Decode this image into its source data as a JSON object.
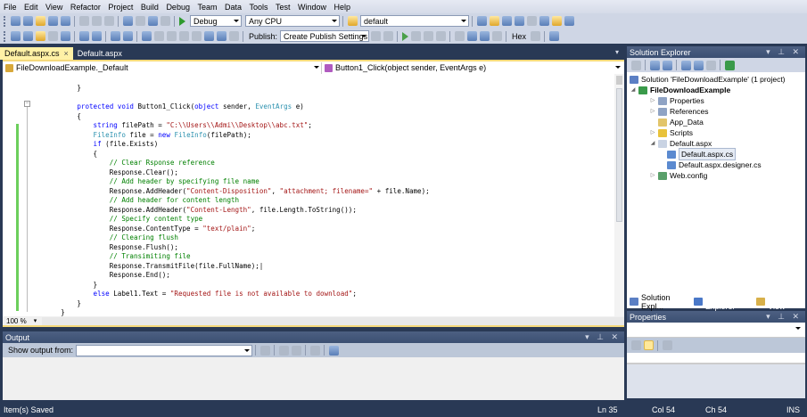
{
  "menu": [
    "File",
    "Edit",
    "View",
    "Refactor",
    "Project",
    "Build",
    "Debug",
    "Team",
    "Data",
    "Tools",
    "Test",
    "Window",
    "Help"
  ],
  "toolbar": {
    "config": "Debug",
    "platform": "Any CPU",
    "find": "default",
    "publish_label": "Publish:",
    "publish_value": "Create Publish Settings",
    "hex": "Hex"
  },
  "tabs": [
    {
      "label": "Default.aspx.cs",
      "close": "×"
    },
    {
      "label": "Default.aspx"
    }
  ],
  "nav": {
    "type": "FileDownloadExample._Default",
    "member": "Button1_Click(object sender, EventArgs e)"
  },
  "code": [
    [
      [
        "p",
        "        }"
      ]
    ],
    [
      [
        "p",
        ""
      ]
    ],
    [
      [
        "p",
        "        "
      ],
      [
        "kw",
        "protected void "
      ],
      [
        "p",
        "Button1_Click("
      ],
      [
        "kw",
        "object"
      ],
      [
        "p",
        " sender, "
      ],
      [
        "ty",
        "EventArgs"
      ],
      [
        "p",
        " e)"
      ]
    ],
    [
      [
        "p",
        "        {"
      ]
    ],
    [
      [
        "p",
        "            "
      ],
      [
        "kw",
        "string"
      ],
      [
        "p",
        " filePath = "
      ],
      [
        "st",
        "\"C:\\\\Users\\\\Admi\\\\Desktop\\\\abc.txt\""
      ],
      [
        "p",
        ";"
      ]
    ],
    [
      [
        "p",
        "            "
      ],
      [
        "ty",
        "FileInfo"
      ],
      [
        "p",
        " file = "
      ],
      [
        "kw",
        "new "
      ],
      [
        "ty",
        "FileInfo"
      ],
      [
        "p",
        "(filePath);"
      ]
    ],
    [
      [
        "p",
        "            "
      ],
      [
        "kw",
        "if"
      ],
      [
        "p",
        " (file.Exists)"
      ]
    ],
    [
      [
        "p",
        "            {"
      ]
    ],
    [
      [
        "p",
        "                "
      ],
      [
        "cm",
        "// Clear Rsponse reference"
      ]
    ],
    [
      [
        "p",
        "                Response.Clear();"
      ]
    ],
    [
      [
        "p",
        "                "
      ],
      [
        "cm",
        "// Add header by specifying file name"
      ]
    ],
    [
      [
        "p",
        "                Response.AddHeader("
      ],
      [
        "st",
        "\"Content-Disposition\""
      ],
      [
        "p",
        ", "
      ],
      [
        "st",
        "\"attachment; filename=\""
      ],
      [
        "p",
        " + file.Name);"
      ]
    ],
    [
      [
        "p",
        "                "
      ],
      [
        "cm",
        "// Add header for content length"
      ]
    ],
    [
      [
        "p",
        "                Response.AddHeader("
      ],
      [
        "st",
        "\"Content-Length\""
      ],
      [
        "p",
        ", file.Length.ToString());"
      ]
    ],
    [
      [
        "p",
        "                "
      ],
      [
        "cm",
        "// Specify content type"
      ]
    ],
    [
      [
        "p",
        "                Response.ContentType = "
      ],
      [
        "st",
        "\"text/plain\""
      ],
      [
        "p",
        ";"
      ]
    ],
    [
      [
        "p",
        "                "
      ],
      [
        "cm",
        "// Clearing flush"
      ]
    ],
    [
      [
        "p",
        "                Response.Flush();"
      ]
    ],
    [
      [
        "p",
        "                "
      ],
      [
        "cm",
        "// Transimiting file"
      ]
    ],
    [
      [
        "p",
        "                Response.TransmitFile(file.FullName);|"
      ]
    ],
    [
      [
        "p",
        "                Response.End();"
      ]
    ],
    [
      [
        "p",
        "            }"
      ]
    ],
    [
      [
        "p",
        "            "
      ],
      [
        "kw",
        "else"
      ],
      [
        "p",
        " Label1.Text = "
      ],
      [
        "st",
        "\"Requested file is not available to download\""
      ],
      [
        "p",
        ";"
      ]
    ],
    [
      [
        "p",
        "        }"
      ]
    ],
    [
      [
        "p",
        "    }"
      ]
    ]
  ],
  "zoom": "100 %",
  "output": {
    "title": "Output",
    "show_label": "Show output from:",
    "source": ""
  },
  "solution_explorer": {
    "title": "Solution Explorer",
    "items": [
      {
        "label": "Solution 'FileDownloadExample' (1 project)",
        "level": 0,
        "exp": "",
        "color": "#5b7fc4"
      },
      {
        "label": "FileDownloadExample",
        "level": 0,
        "exp": "◢",
        "color": "#3a9a4a",
        "bold": true
      },
      {
        "label": "Properties",
        "level": 1,
        "exp": "▷",
        "color": "#8fa3c4"
      },
      {
        "label": "References",
        "level": 1,
        "exp": "▷",
        "color": "#8fa3c4"
      },
      {
        "label": "App_Data",
        "level": 1,
        "exp": "",
        "color": "#e2c56b"
      },
      {
        "label": "Scripts",
        "level": 1,
        "exp": "▷",
        "color": "#e8c23a"
      },
      {
        "label": "Default.aspx",
        "level": 1,
        "exp": "◢",
        "color": "#c9d3e3"
      },
      {
        "label": "Default.aspx.cs",
        "level": 2,
        "exp": "",
        "color": "#5b8ad0",
        "selected": true
      },
      {
        "label": "Default.aspx.designer.cs",
        "level": 2,
        "exp": "",
        "color": "#5b8ad0"
      },
      {
        "label": "Web.config",
        "level": 1,
        "exp": "▷",
        "color": "#5aa06a"
      }
    ],
    "tabs": [
      "Solution Expl...",
      "Team Explorer",
      "Class View"
    ]
  },
  "properties": {
    "title": "Properties",
    "object": ""
  },
  "status": {
    "message": "Item(s) Saved",
    "ln": "Ln 35",
    "col": "Col 54",
    "ch": "Ch 54",
    "mode": "INS"
  }
}
